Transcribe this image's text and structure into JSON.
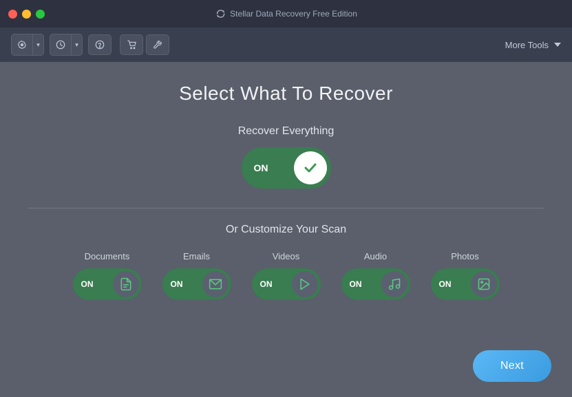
{
  "titleBar": {
    "appName": "Stellar Data Recovery Free Edition"
  },
  "toolbar": {
    "moreTools": "More Tools"
  },
  "main": {
    "pageTitle": "Select What To Recover",
    "recoverEverythingLabel": "Recover Everything",
    "mainToggleState": "ON",
    "customizeScanLabel": "Or Customize Your Scan",
    "categories": [
      {
        "id": "documents",
        "label": "Documents",
        "state": "ON",
        "icon": "document-icon"
      },
      {
        "id": "emails",
        "label": "Emails",
        "state": "ON",
        "icon": "email-icon"
      },
      {
        "id": "videos",
        "label": "Videos",
        "state": "ON",
        "icon": "video-icon"
      },
      {
        "id": "audio",
        "label": "Audio",
        "state": "ON",
        "icon": "audio-icon"
      },
      {
        "id": "photos",
        "label": "Photos",
        "state": "ON",
        "icon": "photos-icon"
      }
    ],
    "nextButton": "Next"
  }
}
